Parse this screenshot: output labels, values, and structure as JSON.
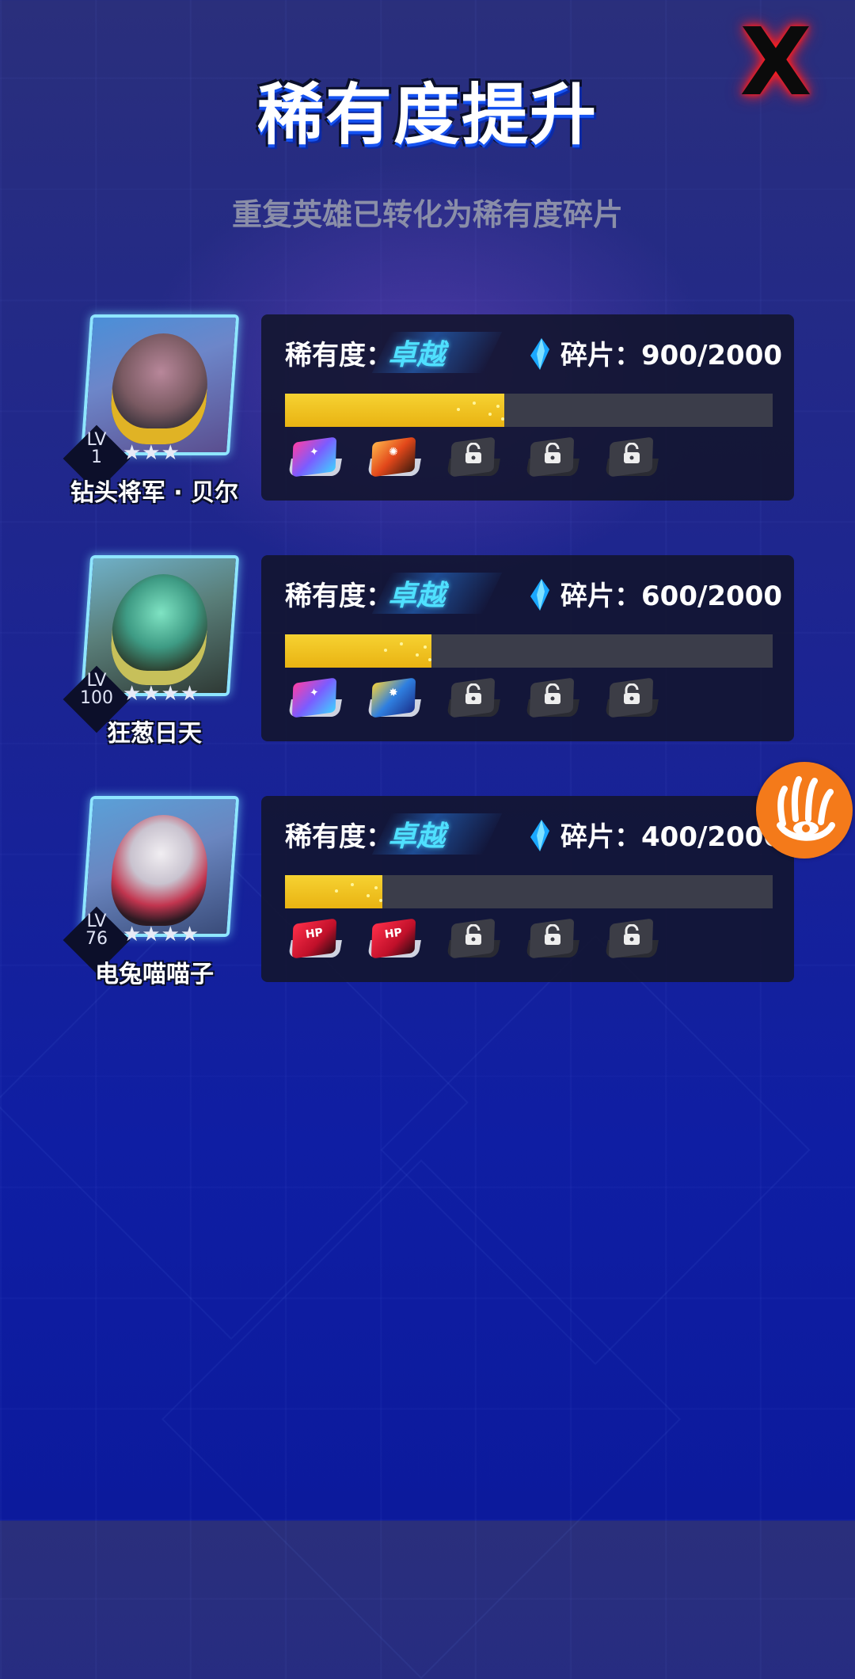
{
  "title": "稀有度提升",
  "subtitle": "重复英雄已转化为稀有度碎片",
  "close_label": "X",
  "colors": {
    "rarity_text": "#4fe0ff",
    "progress_fill": "#f0c21f",
    "progress_track": "#3b3d4a",
    "panel_bg": "#12142c"
  },
  "heroes": [
    {
      "name": "钻头将军 · 贝尔",
      "level_label": "LV",
      "level": "1",
      "stars": "★★★",
      "star_count": 3,
      "rarity_label": "稀有度：",
      "rarity_value": "卓越",
      "shard_text": "碎片：900/2000",
      "shards": 900,
      "shards_max": 2000,
      "progress": 0.45,
      "chips": [
        "colorful-chip",
        "fire-chip",
        "locked-chip",
        "locked-chip",
        "locked-chip"
      ]
    },
    {
      "name": "狂葱日天",
      "level_label": "LV",
      "level": "100",
      "stars": "★★★★",
      "star_count": 4,
      "rarity_label": "稀有度：",
      "rarity_value": "卓越",
      "shard_text": "碎片：600/2000",
      "shards": 600,
      "shards_max": 2000,
      "progress": 0.3,
      "chips": [
        "colorful-chip",
        "blue-burst-chip",
        "locked-chip",
        "locked-chip",
        "locked-chip"
      ]
    },
    {
      "name": "电兔喵喵子",
      "level_label": "LV",
      "level": "76",
      "stars": "★★★★",
      "star_count": 4,
      "rarity_label": "稀有度：",
      "rarity_value": "卓越",
      "shard_text": "碎片：400/2000",
      "shards": 400,
      "shards_max": 2000,
      "progress": 0.2,
      "chips": [
        "red-hp-chip",
        "red-hp-chip",
        "locked-chip",
        "locked-chip",
        "locked-chip"
      ]
    }
  ]
}
